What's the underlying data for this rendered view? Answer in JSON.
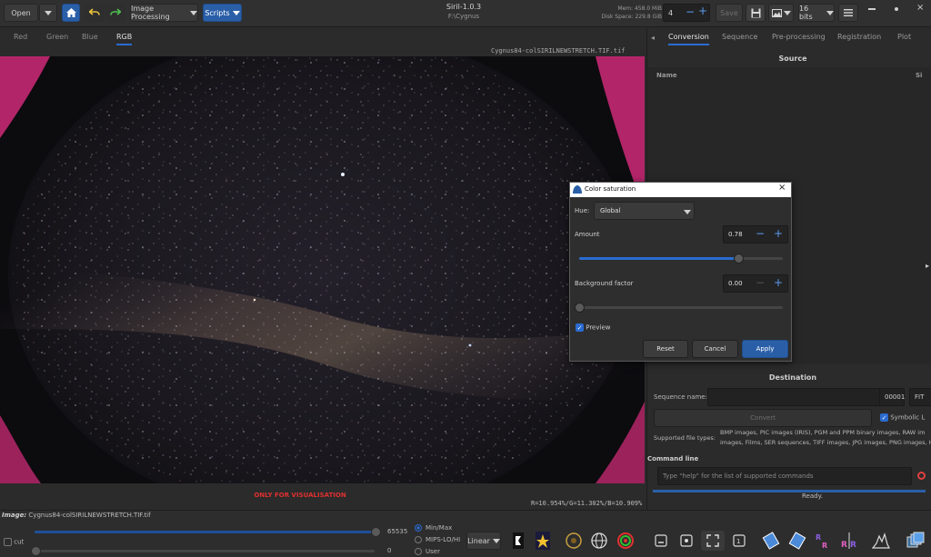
{
  "header": {
    "open_label": "Open",
    "image_processing_label": "Image Processing",
    "scripts_label": "Scripts",
    "app_title": "Siril-1.0.3",
    "working_dir": "F:\\Cygnus",
    "mem_label": "Mem: 458.0 MiB",
    "disk_label": "Disk Space: 229.8 GiB",
    "threads_value": "4",
    "save_label": "Save",
    "bitdepth_label": "16 bits"
  },
  "image_tabs": [
    "Red",
    "Green",
    "Blue",
    "RGB"
  ],
  "viewer": {
    "filename_top": "Cygnus84-colSIRILNEWSTRETCH.TIF.tif",
    "visualisation_label": "ONLY FOR VISUALISATION",
    "rgb_stats": "R=10.954%/G=11.302%/B=10.909%"
  },
  "right_panel": {
    "tabs": [
      "Conversion",
      "Sequence",
      "Pre-processing",
      "Registration",
      "Plot"
    ],
    "source_title": "Source",
    "col_name": "Name",
    "col_size": "Si",
    "destination_title": "Destination",
    "sequence_name_label": "Sequence name:",
    "sequence_number": "00001",
    "fits_label": "FIT",
    "convert_label": "Convert",
    "symbolic_label": "Symbolic L",
    "supported_label": "Supported file types:",
    "supported_text_1": "BMP images, PIC images (IRIS), PGM and PPM binary images, RAW im",
    "supported_text_2": "images, Films, SER sequences, TIFF images, JPG images, PNG images, H",
    "command_line_label": "Command line",
    "command_placeholder": "Type \"help\" for the list of supported commands",
    "status": "Ready."
  },
  "dialog": {
    "title": "Color saturation",
    "hue_label": "Hue:",
    "hue_value": "Global",
    "amount_label": "Amount",
    "amount_value": "0.78",
    "amount_fraction": 0.78,
    "background_label": "Background factor",
    "background_value": "0.00",
    "background_fraction": 0.0,
    "preview_label": "Preview",
    "reset_label": "Reset",
    "cancel_label": "Cancel",
    "apply_label": "Apply"
  },
  "bottom": {
    "image_label": "Image:",
    "image_name": "Cygnus84-colSIRILNEWSTRETCH.TIF.tif",
    "cut_label": "cut",
    "max_value": "65535",
    "min_value": "0",
    "radio_minmax": "Min/Max",
    "radio_mips": "MIPS-LO/HI",
    "radio_user": "User",
    "stretch_label": "Linear"
  },
  "colors": {
    "accent": "#2a6bd1",
    "apply_button": "#2a5fa8",
    "magenta_edge": "#e0307a",
    "red_label": "#e03030"
  }
}
